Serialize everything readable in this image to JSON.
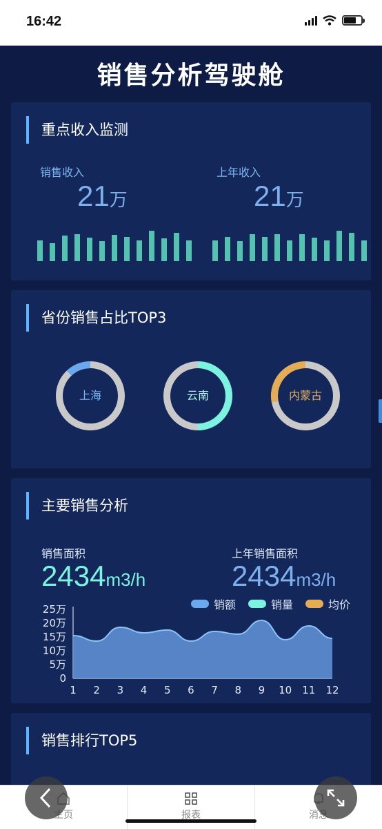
{
  "status_bar": {
    "time": "16:42"
  },
  "page": {
    "title": "销售分析驾驶舱"
  },
  "income_monitor": {
    "title": "重点收入监测",
    "sales_income": {
      "label": "销售收入",
      "value": "21",
      "unit": "万",
      "bars": [
        0.62,
        0.55,
        0.78,
        0.82,
        0.7,
        0.6,
        0.8,
        0.72,
        0.62,
        0.92,
        0.68,
        0.85,
        0.62
      ]
    },
    "last_year_income": {
      "label": "上年收入",
      "value": "21",
      "unit": "万",
      "bars": [
        0.62,
        0.72,
        0.6,
        0.82,
        0.72,
        0.82,
        0.62,
        0.82,
        0.7,
        0.62,
        0.92,
        0.85,
        0.62
      ]
    }
  },
  "province_share": {
    "title": "省份销售占比TOP3",
    "items": [
      {
        "name": "上海",
        "share": 0.12,
        "color": "#6ba9ee",
        "label_color": "#79b4f3"
      },
      {
        "name": "云南",
        "share": 0.5,
        "color": "#7cf2e0",
        "label_color": "#b3f7ee"
      },
      {
        "name": "内蒙古",
        "share": 0.28,
        "color": "#e3ac55",
        "label_color": "#e5b261"
      }
    ],
    "track_color": "#c9c9c9"
  },
  "main_sales": {
    "title": "主要销售分析",
    "sales_area": {
      "label": "销售面积",
      "value": "2434",
      "unit": "m3/h"
    },
    "last_year_area": {
      "label": "上年销售面积",
      "value": "2434",
      "unit": "m3/h"
    },
    "legend": [
      {
        "name": "销额",
        "color": "#6ba9ee"
      },
      {
        "name": "销量",
        "color": "#7cf2e0"
      },
      {
        "name": "均价",
        "color": "#e3ac55"
      }
    ]
  },
  "chart_data": {
    "type": "area",
    "x": [
      "1",
      "2",
      "3",
      "4",
      "5",
      "6",
      "7",
      "8",
      "9",
      "10",
      "11",
      "12"
    ],
    "series": [
      {
        "name": "销额",
        "values": [
          15.5,
          13.5,
          18.5,
          16.5,
          17.5,
          13.5,
          17,
          16,
          21,
          14,
          19,
          14.5
        ]
      }
    ],
    "yticks": [
      "0",
      "5万",
      "10万",
      "15万",
      "20万",
      "25万"
    ],
    "ylim": [
      0,
      25
    ],
    "grid": false,
    "legend_position": "top-right",
    "colors": {
      "fill": "#5d8fd3",
      "stroke": "#8cc2f7"
    }
  },
  "ranking": {
    "title": "销售排行TOP5"
  },
  "bottom_nav": {
    "tabs": [
      {
        "label": "主页",
        "icon": "home-icon"
      },
      {
        "label": "报表",
        "icon": "grid-icon"
      },
      {
        "label": "消息",
        "icon": "bell-icon"
      }
    ]
  }
}
